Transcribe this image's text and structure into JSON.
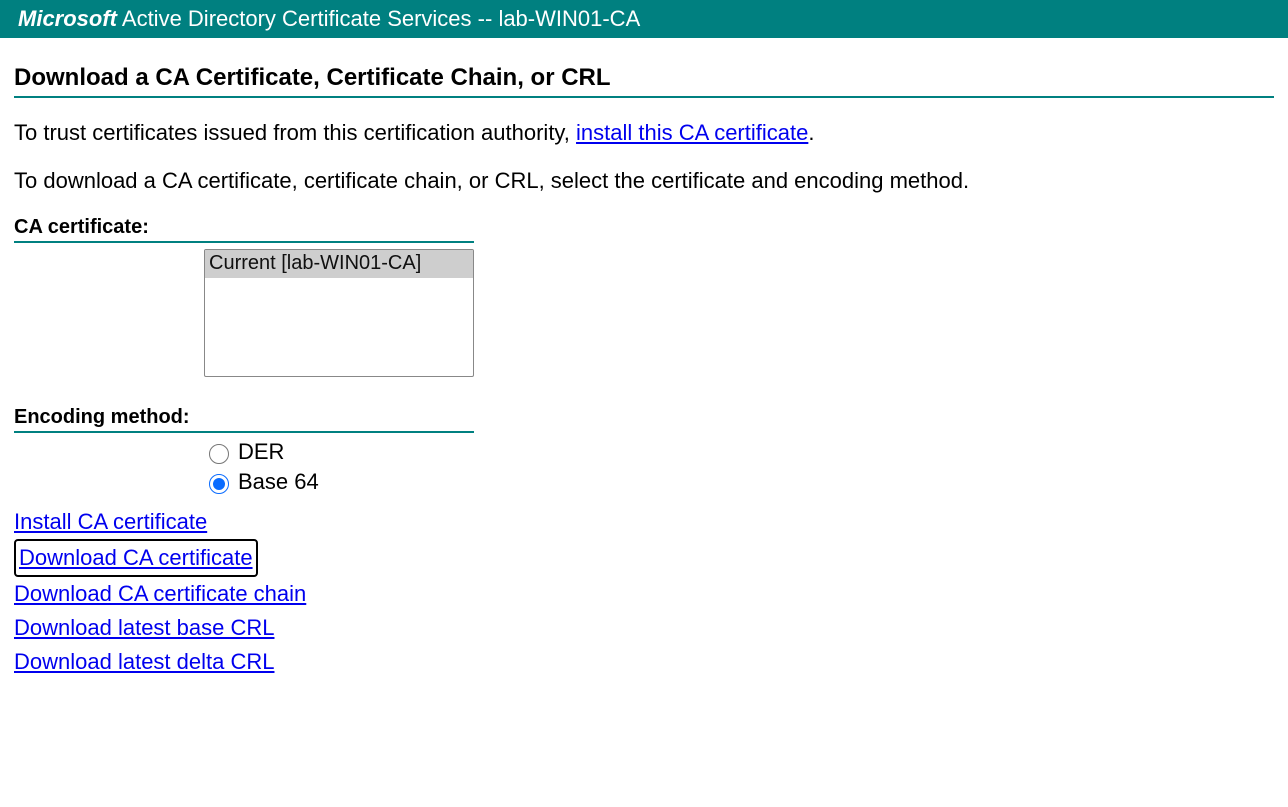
{
  "banner": {
    "brand": "Microsoft",
    "product": " Active Directory Certificate Services  -- ",
    "ca_name": " lab-WIN01-CA"
  },
  "page": {
    "title": "Download a CA Certificate, Certificate Chain, or CRL",
    "intro1_prefix": "To trust certificates issued from this certification authority, ",
    "intro1_link": "install this CA certificate",
    "intro1_suffix": ".",
    "intro2": "To download a CA certificate, certificate chain, or CRL, select the certificate and encoding method."
  },
  "ca_certificate": {
    "label": "CA certificate:",
    "options": [
      "Current [lab-WIN01-CA]"
    ]
  },
  "encoding": {
    "label": "Encoding method:",
    "der": "DER",
    "base64": "Base 64"
  },
  "actions": {
    "install_ca": "Install CA certificate",
    "download_ca": "Download CA certificate",
    "download_chain": "Download CA certificate chain",
    "download_base_crl": "Download latest base CRL",
    "download_delta_crl": "Download latest delta CRL"
  }
}
